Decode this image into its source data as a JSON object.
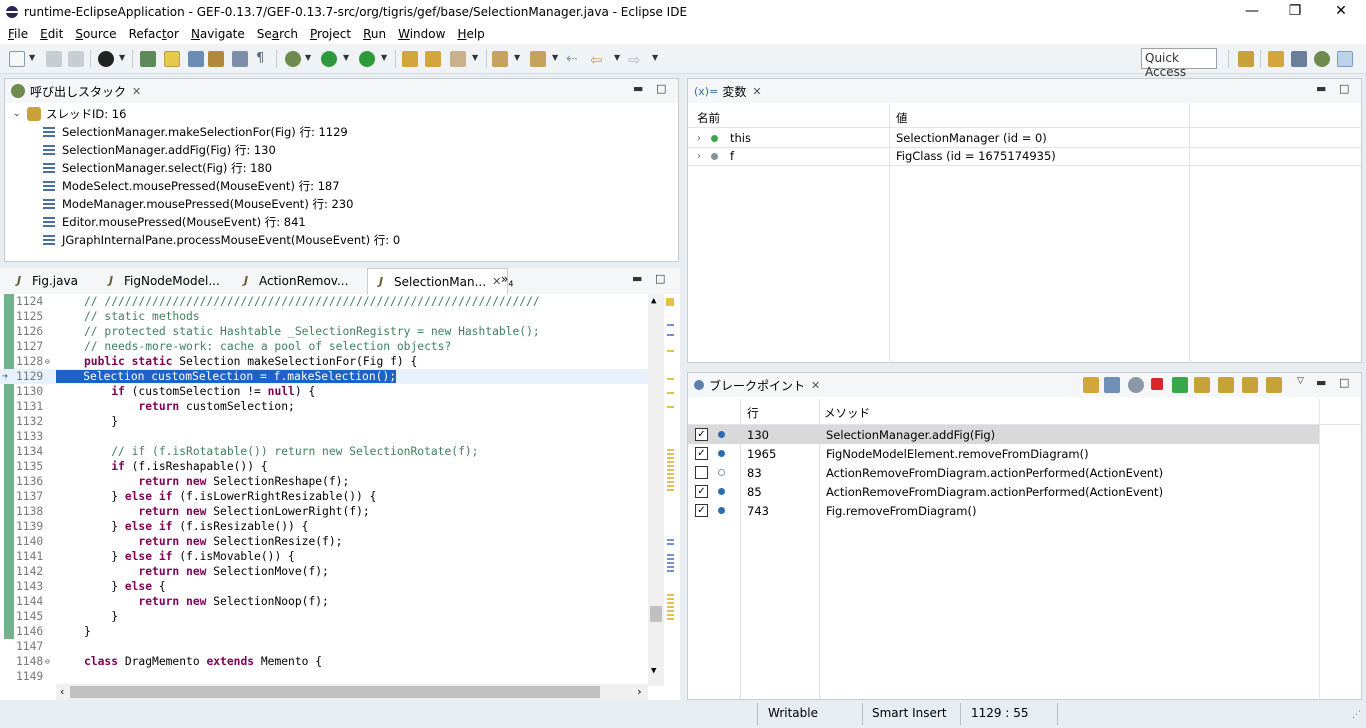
{
  "window": {
    "title": "runtime-EclipseApplication - GEF-0.13.7/GEF-0.13.7-src/org/tigris/gef/base/SelectionManager.java - Eclipse IDE",
    "minimize": "—",
    "restore": "❐",
    "close": "✕"
  },
  "menu": [
    {
      "mnemonic": "F",
      "rest": "ile"
    },
    {
      "mnemonic": "E",
      "rest": "dit"
    },
    {
      "mnemonic": "S",
      "rest": "ource"
    },
    {
      "mnemonic": "",
      "rest": "Refac",
      "mnemonic2": "t",
      "rest2": "or"
    },
    {
      "mnemonic": "N",
      "rest": "avigate"
    },
    {
      "mnemonic": "",
      "rest": "Se",
      "mnemonic2": "a",
      "rest2": "rch"
    },
    {
      "mnemonic": "P",
      "rest": "roject"
    },
    {
      "mnemonic": "R",
      "rest": "un"
    },
    {
      "mnemonic": "W",
      "rest": "indow"
    },
    {
      "mnemonic": "H",
      "rest": "elp"
    }
  ],
  "toolbar": {
    "quick_access": "Quick Access"
  },
  "callstack": {
    "tab_label": "呼び出しスタック",
    "thread": "スレッドID: 16",
    "frames": [
      "SelectionManager.makeSelectionFor(Fig) 行: 1129",
      "SelectionManager.addFig(Fig) 行: 130",
      "SelectionManager.select(Fig) 行: 180",
      "ModeSelect.mousePressed(MouseEvent) 行: 187",
      "ModeManager.mousePressed(MouseEvent) 行: 230",
      "Editor.mousePressed(MouseEvent) 行: 841",
      "JGraphInternalPane.processMouseEvent(MouseEvent) 行: 0"
    ]
  },
  "variables": {
    "tab_prefix": "(x)=",
    "tab_label": "変数",
    "col_name": "名前",
    "col_value": "値",
    "rows": [
      {
        "name": "this",
        "value": "SelectionManager (id = 0)"
      },
      {
        "name": "f",
        "value": "FigClass (id = 1675174935)"
      }
    ]
  },
  "editor": {
    "tabs": [
      "Fig.java",
      "FigNodeModel...",
      "ActionRemov...",
      "SelectionMan..."
    ],
    "overflow": "»",
    "overflow_count": "4",
    "lines": [
      {
        "n": "1124",
        "t": "// ////////////////////////////////////////////////////////////////",
        "k": "cm"
      },
      {
        "n": "1125",
        "t": "// static methods",
        "k": "cm"
      },
      {
        "n": "1126",
        "t": "// protected static Hashtable _SelectionRegistry = new Hashtable();",
        "k": "cm"
      },
      {
        "n": "1127",
        "t": "// needs-more-work: cache a pool of selection objects?",
        "k": "cm"
      },
      {
        "n": "1128",
        "kw": "public static",
        "t": " Selection makeSelectionFor(Fig f) {",
        "k": "kw"
      },
      {
        "n": "1129",
        "t": "    Selection customSelection = f.makeSelection();",
        "k": "hl"
      },
      {
        "n": "1130",
        "kw": "    if",
        "t": " (customSelection != ",
        "kw2": "null",
        "t2": ") {",
        "k": "kw2"
      },
      {
        "n": "1131",
        "kw": "        return",
        "t": " customSelection;",
        "k": "kw"
      },
      {
        "n": "1132",
        "t": "    }",
        "k": ""
      },
      {
        "n": "1133",
        "t": "",
        "k": ""
      },
      {
        "n": "1134",
        "t": "    // if (f.isRotatable()) return new SelectionRotate(f);",
        "k": "cm"
      },
      {
        "n": "1135",
        "kw": "    if",
        "t": " (f.isReshapable()) {",
        "k": "kw"
      },
      {
        "n": "1136",
        "kw": "        return new",
        "t": " SelectionReshape(f);",
        "k": "kw"
      },
      {
        "n": "1137",
        "t": "    } ",
        "kw2": "else if",
        "t2": " (f.isLowerRightResizable()) {",
        "k": "mid"
      },
      {
        "n": "1138",
        "kw": "        return new",
        "t": " SelectionLowerRight(f);",
        "k": "kw"
      },
      {
        "n": "1139",
        "t": "    } ",
        "kw2": "else if",
        "t2": " (f.isResizable()) {",
        "k": "mid"
      },
      {
        "n": "1140",
        "kw": "        return new",
        "t": " SelectionResize(f);",
        "k": "kw"
      },
      {
        "n": "1141",
        "t": "    } ",
        "kw2": "else if",
        "t2": " (f.isMovable()) {",
        "k": "mid"
      },
      {
        "n": "1142",
        "kw": "        return new",
        "t": " SelectionMove(f);",
        "k": "kw"
      },
      {
        "n": "1143",
        "t": "    } ",
        "kw2": "else",
        "t2": " {",
        "k": "mid"
      },
      {
        "n": "1144",
        "kw": "        return new",
        "t": " SelectionNoop(f);",
        "k": "kw"
      },
      {
        "n": "1145",
        "t": "    }",
        "k": ""
      },
      {
        "n": "1146",
        "t": "}",
        "k": ""
      },
      {
        "n": "1147",
        "t": "",
        "k": ""
      },
      {
        "n": "1148",
        "kw": "class",
        "t": " DragMemento ",
        "kw2": "extends",
        "t2": " Memento {",
        "k": "kw2"
      },
      {
        "n": "1149",
        "t": "",
        "k": ""
      }
    ]
  },
  "breakpoints": {
    "tab_label": "ブレークポイント",
    "col_line": "行",
    "col_method": "メソッド",
    "rows": [
      {
        "checked": true,
        "enabled": true,
        "line": "130",
        "method": "SelectionManager.addFig(Fig)"
      },
      {
        "checked": true,
        "enabled": true,
        "line": "1965",
        "method": "FigNodeModelElement.removeFromDiagram()"
      },
      {
        "checked": false,
        "enabled": false,
        "line": "83",
        "method": "ActionRemoveFromDiagram.actionPerformed(ActionEvent)"
      },
      {
        "checked": true,
        "enabled": true,
        "line": "85",
        "method": "ActionRemoveFromDiagram.actionPerformed(ActionEvent)"
      },
      {
        "checked": true,
        "enabled": true,
        "line": "743",
        "method": "Fig.removeFromDiagram()"
      }
    ]
  },
  "status": {
    "writable": "Writable",
    "insert_mode": "Smart Insert",
    "position": "1129 : 55"
  },
  "colors": {
    "keyword": "#7f0055",
    "comment": "#3f7f5f",
    "highlight": "#1c63c8"
  }
}
